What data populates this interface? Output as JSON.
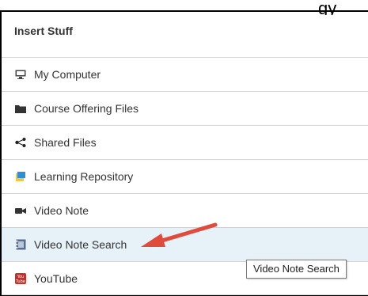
{
  "page_stub_text": "gy",
  "panel": {
    "title": "Insert Stuff",
    "items": [
      {
        "label": "My Computer",
        "icon": "computer-icon"
      },
      {
        "label": "Course Offering Files",
        "icon": "folder-icon"
      },
      {
        "label": "Shared Files",
        "icon": "share-icon"
      },
      {
        "label": "Learning Repository",
        "icon": "repository-icon"
      },
      {
        "label": "Video Note",
        "icon": "video-camera-icon"
      },
      {
        "label": "Video Note Search",
        "icon": "video-search-icon"
      },
      {
        "label": "YouTube",
        "icon": "youtube-icon"
      }
    ],
    "selected_index": 5
  },
  "tooltip": {
    "text": "Video Note Search"
  },
  "colors": {
    "arrow": "#e14b3b",
    "selected_bg": "#e6f1f8"
  }
}
